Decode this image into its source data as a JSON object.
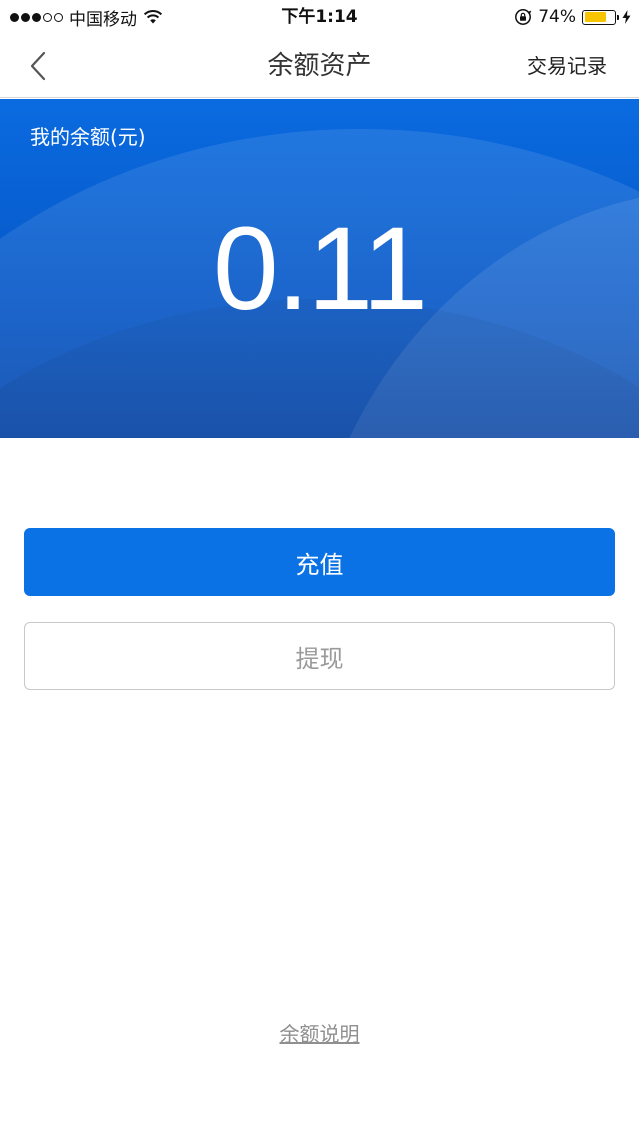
{
  "status_bar": {
    "carrier": "中国移动",
    "time": "下午1:14",
    "battery_percent": "74%",
    "battery_level": 0.74,
    "signal_filled": 3,
    "signal_total": 5,
    "icons": [
      "wifi-icon",
      "orientation-lock-icon",
      "battery-icon",
      "charging-bolt-icon"
    ]
  },
  "nav": {
    "title": "余额资产",
    "action_label": "交易记录",
    "back_icon": "chevron-left-icon"
  },
  "balance": {
    "label": "我的余额(元)",
    "value": "0.11"
  },
  "actions": {
    "recharge_label": "充值",
    "withdraw_label": "提现"
  },
  "footer": {
    "link_label": "余额说明"
  },
  "colors": {
    "primary": "#0a72e4",
    "card_top": "#0a6be0",
    "card_bottom": "#0a4aae",
    "battery_fill": "#f7c500",
    "muted_text": "#9a9a9a"
  }
}
